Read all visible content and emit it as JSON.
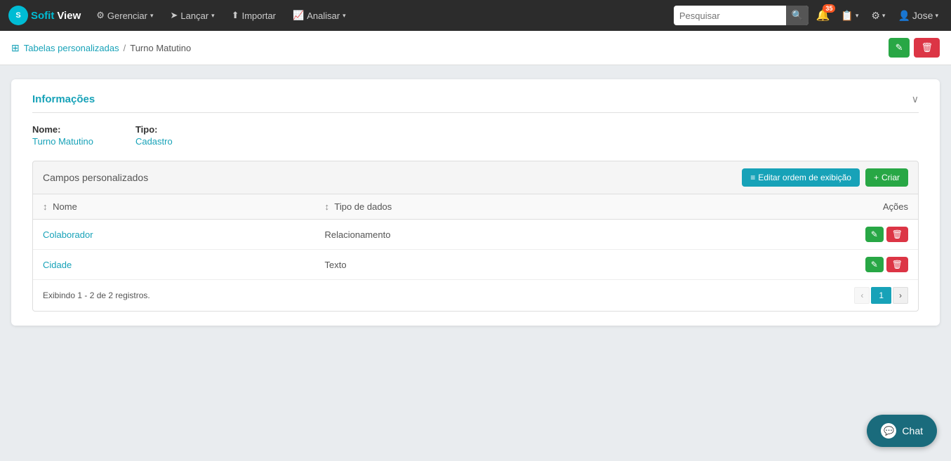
{
  "brand": {
    "logo_text": "S",
    "sofit": "Sofit",
    "view": "View"
  },
  "navbar": {
    "items": [
      {
        "id": "gerenciar",
        "label": "Gerenciar",
        "icon": "gear",
        "has_dropdown": true
      },
      {
        "id": "lancar",
        "label": "Lançar",
        "icon": "arrow",
        "has_dropdown": true
      },
      {
        "id": "importar",
        "label": "Importar",
        "icon": "upload",
        "has_dropdown": false
      },
      {
        "id": "analisar",
        "label": "Analisar",
        "icon": "chart",
        "has_dropdown": true
      }
    ],
    "search_placeholder": "Pesquisar",
    "notifications_count": "35",
    "user_name": "Jose"
  },
  "breadcrumb": {
    "icon": "⊞",
    "parent_link": "Tabelas personalizadas",
    "separator": "/",
    "current": "Turno Matutino"
  },
  "page_actions": {
    "edit_icon": "✎",
    "delete_icon": "🗑"
  },
  "info_section": {
    "title": "Informações",
    "toggle_icon": "∨",
    "fields": [
      {
        "label": "Nome:",
        "value": "Turno Matutino"
      },
      {
        "label": "Tipo:",
        "value": "Cadastro"
      }
    ]
  },
  "campos_section": {
    "title": "Campos personalizados",
    "btn_order_icon": "≡",
    "btn_order_label": "Editar ordem de exibição",
    "btn_create_icon": "+",
    "btn_create_label": "Criar",
    "table": {
      "columns": [
        {
          "sort_icon": "↕",
          "label": "Nome"
        },
        {
          "sort_icon": "↕",
          "label": "Tipo de dados"
        },
        {
          "label": "Ações"
        }
      ],
      "rows": [
        {
          "nome": "Colaborador",
          "tipo": "Relacionamento"
        },
        {
          "nome": "Cidade",
          "tipo": "Texto"
        }
      ]
    },
    "footer": {
      "text": "Exibindo 1 - 2 de 2 registros.",
      "prev_icon": "‹",
      "page": "1",
      "next_icon": "›"
    }
  },
  "chat": {
    "icon": "💬",
    "label": "Chat"
  }
}
